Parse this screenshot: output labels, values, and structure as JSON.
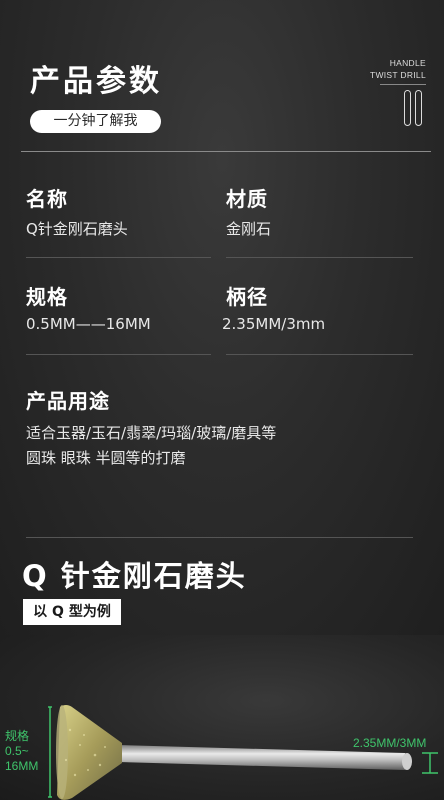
{
  "header": {
    "title": "产品参数",
    "subtitle": "一分钟了解我",
    "handle_line1": "HANDLE",
    "handle_line2": "TWIST DRILL"
  },
  "specs": [
    {
      "label": "名称",
      "value": "Q针金刚石磨头"
    },
    {
      "label": "材质",
      "value": "金刚石"
    },
    {
      "label": "规格",
      "value": "0.5MM——16MM"
    },
    {
      "label": "柄径",
      "value": "2.35MM/3mm"
    }
  ],
  "usage": {
    "label": "产品用途",
    "line1": "适合玉器/玉石/翡翠/玛瑙/玻璃/磨具等",
    "line2": "圆珠 眼珠 半圆等的打磨"
  },
  "product": {
    "title": "Q 针金刚石磨头",
    "tag": "以 Q 型为例"
  },
  "image_annotations": {
    "left_label": "规格",
    "left_range_1": "0.5~",
    "left_range_2": "16MM",
    "right_label": "2.35MM/3MM"
  },
  "colors": {
    "accent_green": "#3fc46b",
    "background": "#262626"
  }
}
